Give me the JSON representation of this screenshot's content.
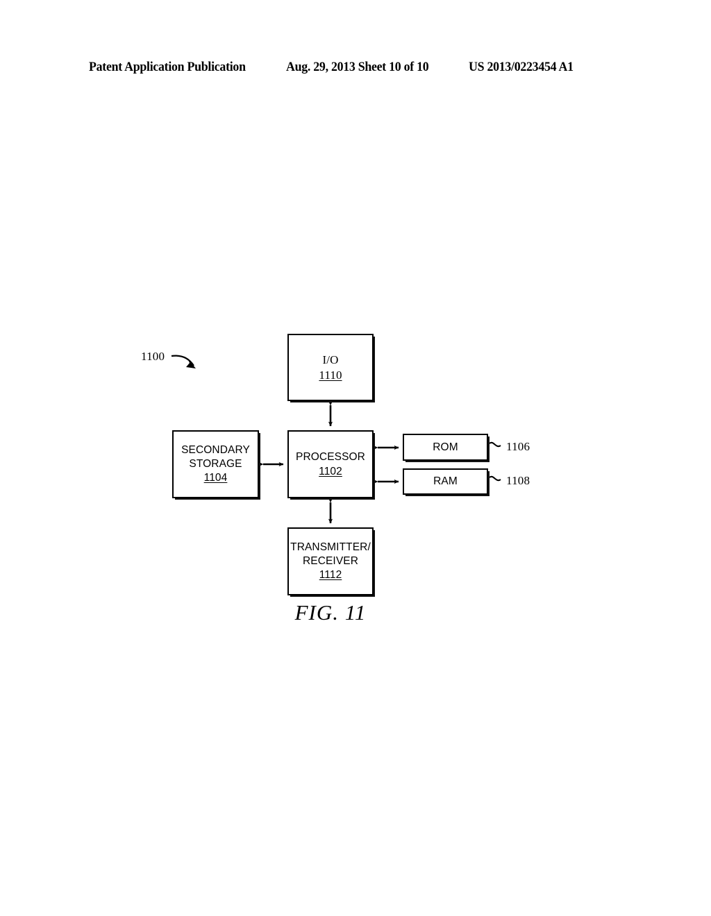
{
  "header": {
    "left": "Patent Application Publication",
    "center": "Aug. 29, 2013  Sheet 10 of 10",
    "right": "US 2013/0223454 A1"
  },
  "figure": {
    "caption": "FIG. 11",
    "system_ref": "1100",
    "nodes": [
      {
        "id": "io",
        "label": "I/O",
        "ref": "1110"
      },
      {
        "id": "processor",
        "label": "PROCESSOR",
        "ref": "1102"
      },
      {
        "id": "secondary",
        "label_line1": "SECONDARY",
        "label_line2": "STORAGE",
        "ref": "1104"
      },
      {
        "id": "rom",
        "label": "ROM",
        "ref": "1106"
      },
      {
        "id": "ram",
        "label": "RAM",
        "ref": "1108"
      },
      {
        "id": "txrx",
        "label_line1": "TRANSMITTER/",
        "label_line2": "RECEIVER",
        "ref": "1112"
      }
    ],
    "callouts": {
      "rom_ref": "1106",
      "ram_ref": "1108"
    }
  },
  "colors": {
    "ink": "#000000",
    "paper": "#ffffff"
  }
}
